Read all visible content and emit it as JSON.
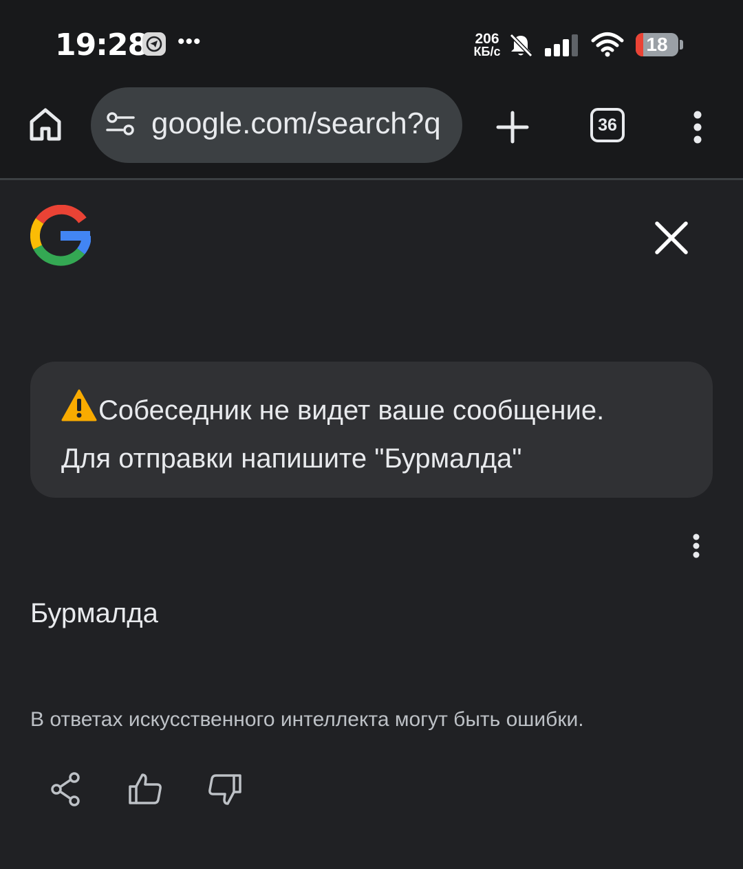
{
  "status_bar": {
    "time": "19:28",
    "speed_value": "206",
    "speed_unit": "КБ/с",
    "battery_level": "18",
    "battery_percent": 18,
    "battery_color": "#ea4335",
    "icons": [
      "telegram-icon",
      "more-notifications-icon",
      "bell-off-icon",
      "signal-icon",
      "wifi-icon",
      "battery-icon"
    ]
  },
  "toolbar": {
    "url": "google.com/search?q",
    "tab_count": "36",
    "icons": [
      "home-icon",
      "site-settings-icon",
      "new-tab-icon",
      "tabs-icon",
      "menu-icon"
    ]
  },
  "content": {
    "message": {
      "line1": "Собеседник не видет ваше сообщение.",
      "line2": "Для отправки напишите \"Бурмалда\"",
      "icon": "warning-icon"
    },
    "answer": "Бурмалда",
    "disclaimer": "В ответах искусственного интеллекта могут быть ошибки.",
    "actions": [
      "share-icon",
      "thumbs-up-icon",
      "thumbs-down-icon"
    ]
  },
  "colors": {
    "background": "#202124",
    "card": "#303134",
    "omnibox": "#3c4043",
    "google_blue": "#4285f4",
    "google_red": "#ea4335",
    "google_yellow": "#fbbc05",
    "google_green": "#34a853"
  }
}
